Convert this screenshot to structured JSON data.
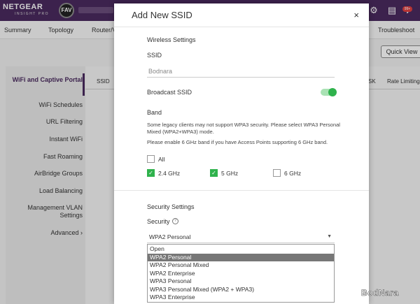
{
  "header": {
    "brand": "NETGEAR",
    "brand_sub": "INSIGHT PRO",
    "org_badge": "FAV",
    "notif_badge": "99+"
  },
  "nav": {
    "tabs": [
      "Summary",
      "Topology",
      "Router/V",
      "Troubleshoot"
    ]
  },
  "quick_view": "Quick View",
  "sidebar": {
    "items": [
      "WiFi and Captive Portal",
      "WiFi Schedules",
      "URL Filtering",
      "Instant WiFi",
      "Fast Roaming",
      "AirBridge Groups",
      "Load Balancing",
      "Management VLAN Settings",
      "Advanced ›"
    ]
  },
  "background_table": {
    "columns": [
      "SSID",
      "SK",
      "Rate Limiting"
    ]
  },
  "modal": {
    "title": "Add New SSID",
    "close": "×",
    "wireless_title": "Wireless Settings",
    "ssid_label": "SSID",
    "ssid_value": "Bodnara",
    "broadcast_label": "Broadcast SSID",
    "band_label": "Band",
    "band_note_1": "Some legacy clients may not support WPA3 security. Please select WPA3 Personal Mixed (WPA2+WPA3) mode.",
    "band_note_2": "Please enable 6 GHz band if you have Access Points supporting 6 GHz band.",
    "bands": {
      "all": "All",
      "g24": "2.4 GHz",
      "g5": "5 GHz",
      "g6": "6 GHz"
    },
    "security_title": "Security Settings",
    "security_label": "Security",
    "security_value": "WPA2 Personal",
    "security_options": [
      "Open",
      "WPA2 Personal",
      "WPA2 Personal Mixed",
      "WPA2 Enterprise",
      "WPA3 Personal",
      "WPA3 Personal Mixed (WPA2 + WPA3)",
      "WPA3 Enterprise"
    ]
  },
  "watermark": "BodNara",
  "colors": {
    "header": "#4a2a5e",
    "accent_green": "#2fb24c"
  }
}
